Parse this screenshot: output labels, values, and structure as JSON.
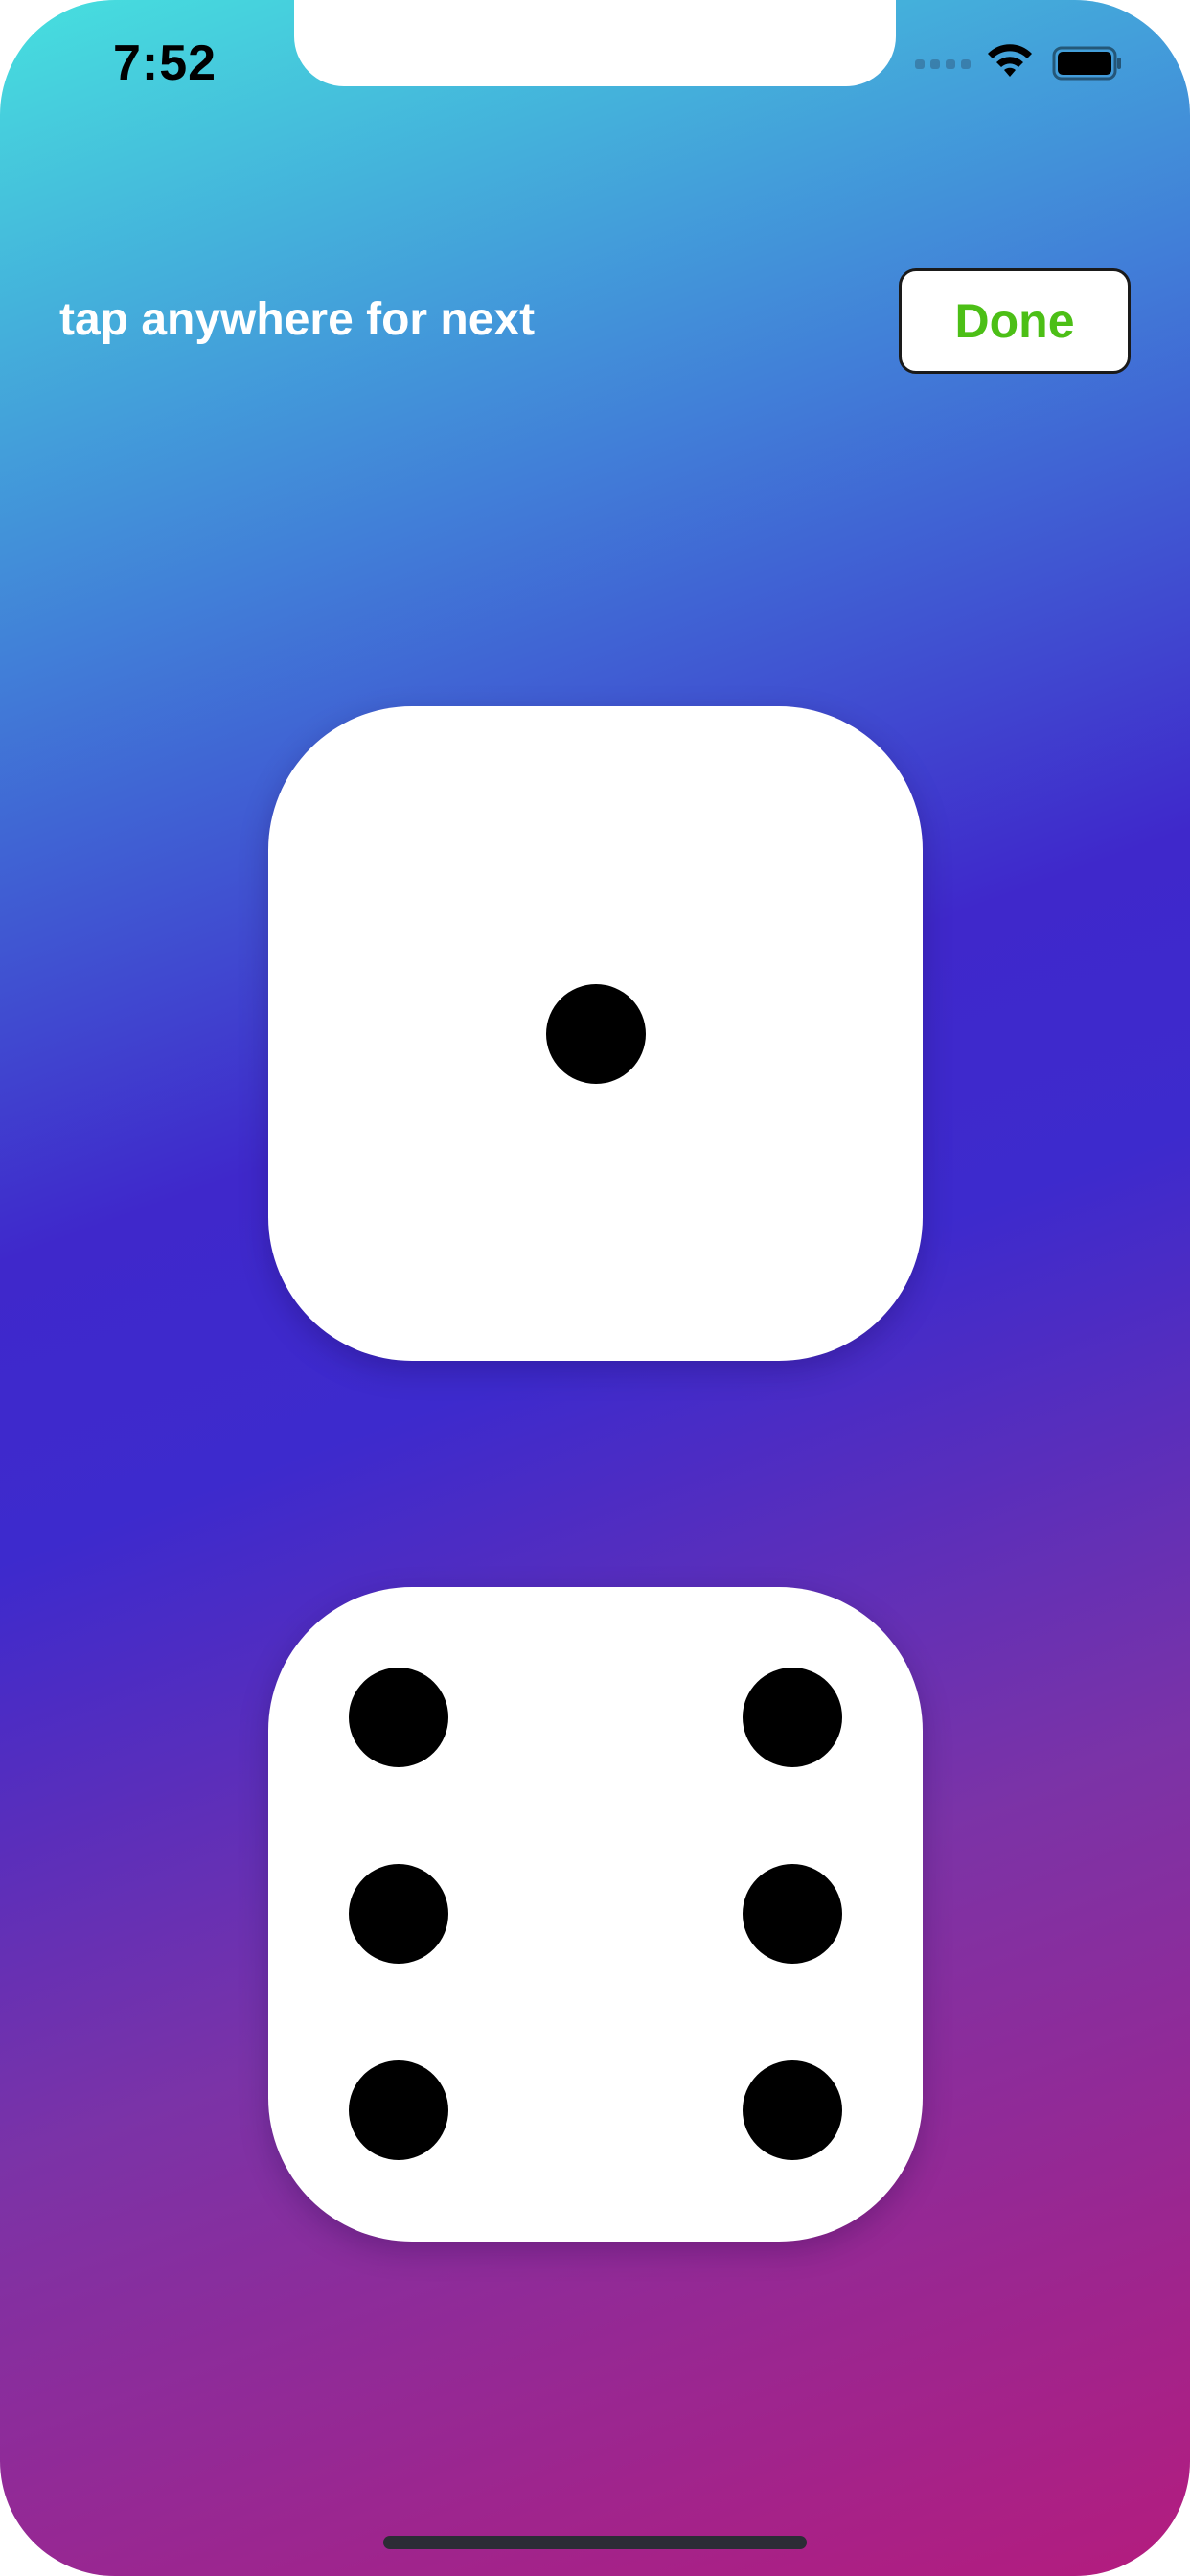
{
  "status_bar": {
    "time": "7:52",
    "icons": [
      "signal-icon",
      "wifi-icon",
      "battery-icon"
    ]
  },
  "header": {
    "hint_text": "tap anywhere for next",
    "done_label": "Done",
    "done_color": "#4cbf16"
  },
  "dice": [
    {
      "name": "top-die",
      "value": 1
    },
    {
      "name": "bottom-die",
      "value": 6
    }
  ],
  "colors": {
    "gradient_start": "#47e0de",
    "gradient_mid": "#3f28cb",
    "gradient_end": "#b41c7e",
    "die_face": "#ffffff",
    "pip": "#000000"
  }
}
